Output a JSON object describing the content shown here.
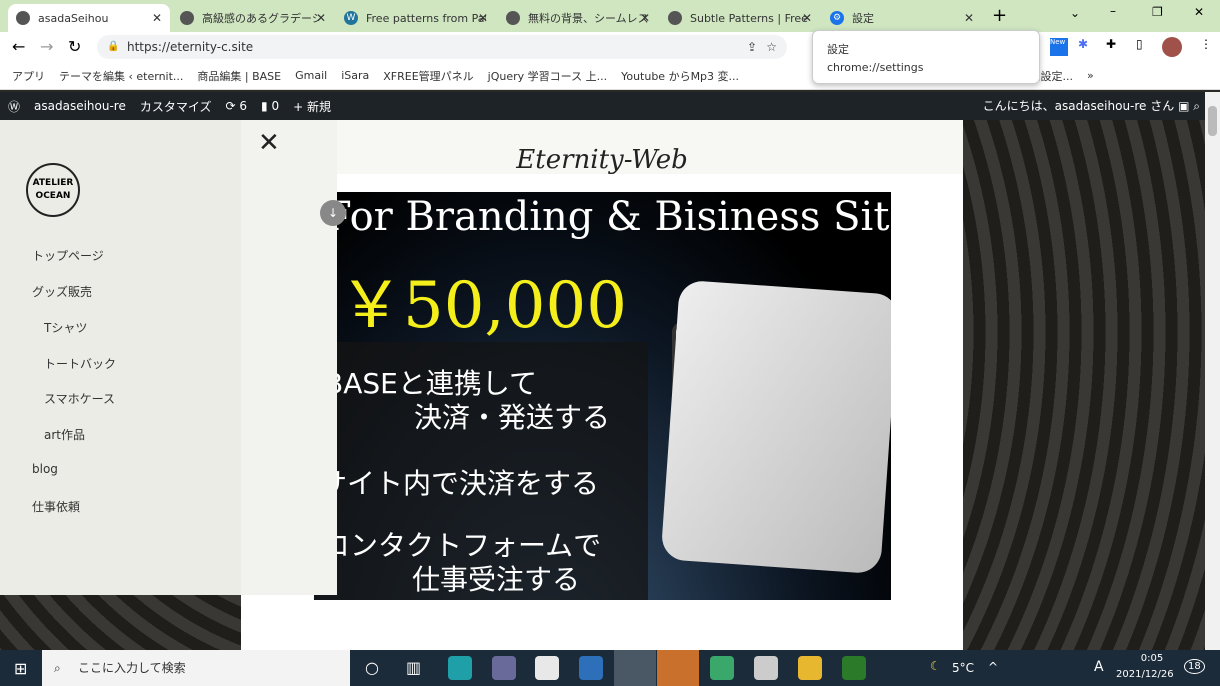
{
  "tabs": [
    {
      "title": "asadaSeihou",
      "active": true
    },
    {
      "title": "高級感のあるグラデーショ"
    },
    {
      "title": "Free patterns from Pat"
    },
    {
      "title": "無料の背景、シームレスな"
    },
    {
      "title": "Subtle Patterns | Free"
    },
    {
      "title": "設定"
    }
  ],
  "address": {
    "url": "https://eternity-c.site"
  },
  "popup": {
    "title": "設定",
    "url": "chrome://settings"
  },
  "bookmarks": [
    "アプリ",
    "テーマを編集 ‹ eternit...",
    "商品編集 | BASE",
    "Gmail",
    "iSara",
    "XFREE管理パネル",
    "jQuery 学習コース 上...",
    "Youtube からMp3 変...",
    "残高 – 名称未設定..."
  ],
  "wpbar": {
    "site": "asadaseihou-re",
    "customize": "カスタマイズ",
    "updates": "6",
    "comments": "0",
    "new": "新規",
    "greeting": "こんにちは、asadaseihou-re さん"
  },
  "site": {
    "title": "Eternity-Web",
    "logo": "ATELIER OCEAN"
  },
  "menu": [
    "トップページ",
    "グッズ販売",
    "Tシャツ",
    "トートバック",
    "スマホケース",
    "art作品",
    "blog",
    "仕事依頼"
  ],
  "banner": {
    "title": "For Branding & Bisiness Site",
    "price": "￥50,000",
    "line1": "BASEと連携して",
    "line2": "決済・発送する",
    "line3": "サイト内で決済をする",
    "line4": "コンタクトフォームで",
    "line5": "仕事受注する"
  },
  "taskbar": {
    "search_placeholder": "ここに入力して検索",
    "weather": "5°C",
    "ime": "A",
    "time": "0:05",
    "date": "2021/12/26",
    "notifications": "18"
  }
}
